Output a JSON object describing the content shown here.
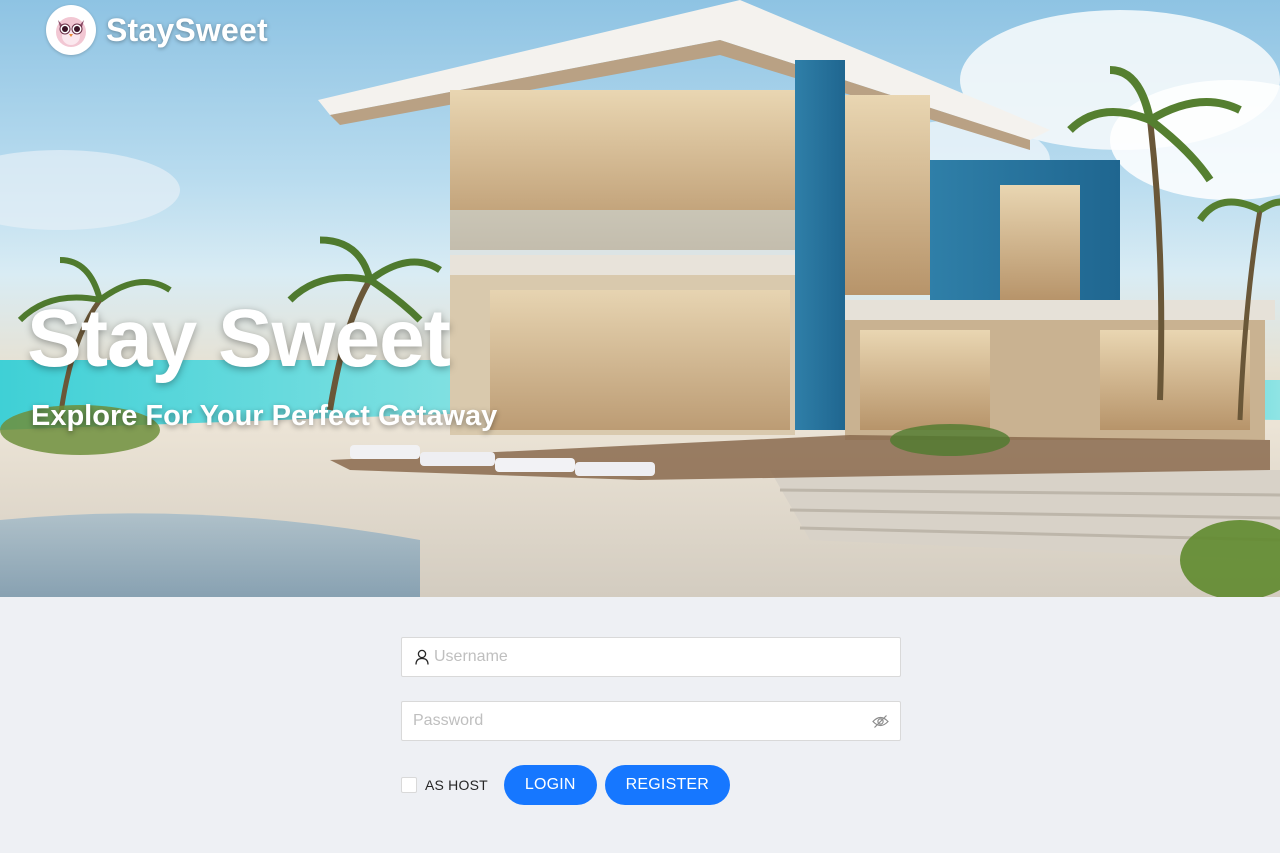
{
  "brand": {
    "name": "StaySweet",
    "logo_icon": "owl-logo-icon"
  },
  "hero": {
    "title": "Stay Sweet",
    "subtitle": "Explore For Your Perfect Getaway"
  },
  "login_form": {
    "username": {
      "placeholder": "Username",
      "value": "",
      "icon": "user-icon"
    },
    "password": {
      "placeholder": "Password",
      "value": "",
      "icon": "eye-invisible-icon"
    },
    "as_host_label": "AS HOST",
    "as_host_checked": false,
    "login_label": "LOGIN",
    "register_label": "REGISTER"
  },
  "colors": {
    "primary": "#1677ff",
    "page_background": "#eef0f4",
    "input_border": "#d9d9d9",
    "placeholder": "#bfbfbf"
  }
}
